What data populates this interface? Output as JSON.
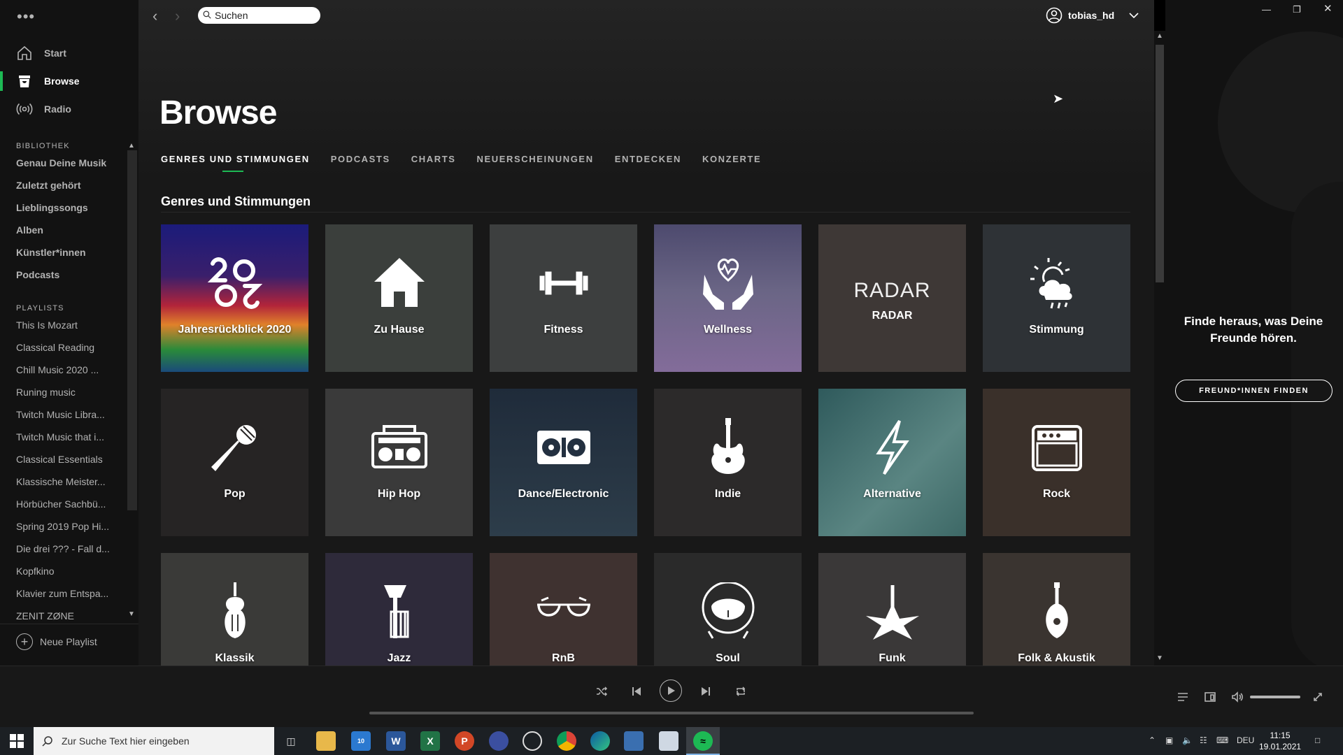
{
  "topbar": {
    "search_placeholder": "Suchen",
    "username": "tobias_hd"
  },
  "sidebar": {
    "nav": [
      {
        "label": "Start",
        "icon": "home-icon"
      },
      {
        "label": "Browse",
        "icon": "browse-icon",
        "active": true
      },
      {
        "label": "Radio",
        "icon": "radio-icon"
      }
    ],
    "library_heading": "BIBLIOTHEK",
    "library": [
      "Genau Deine Musik",
      "Zuletzt gehört",
      "Lieblingssongs",
      "Alben",
      "Künstler*innen",
      "Podcasts"
    ],
    "playlists_heading": "PLAYLISTS",
    "playlists": [
      "This Is Mozart",
      "Classical Reading",
      "Chill Music 2020 ...",
      "Runing music",
      "Twitch Music Libra...",
      "Twitch Music that i...",
      "Classical Essentials",
      "Klassische Meister...",
      "Hörbücher Sachbü...",
      "Spring 2019 Pop Hi...",
      "Die drei ??? - Fall d...",
      "Kopfkino",
      "Klavier zum Entspa...",
      "ZENIT ZØNE"
    ],
    "new_playlist": "Neue Playlist"
  },
  "main": {
    "title": "Browse",
    "tabs": [
      "GENRES UND STIMMUNGEN",
      "PODCASTS",
      "CHARTS",
      "NEUERSCHEINUNGEN",
      "ENTDECKEN",
      "KONZERTE"
    ],
    "section_title": "Genres und Stimmungen",
    "tiles": [
      {
        "label": "Jahresrückblick 2020",
        "icon": "year-2020-icon",
        "bg": "linear-gradient(180deg,#1b1b7a 0%,#3a1f6b 35%,#b2243a 55%,#e0812a 68%,#2a8a3a 85%,#1a4a7a 100%)"
      },
      {
        "label": "Zu Hause",
        "icon": "house-icon",
        "bg": "#3b3f3c"
      },
      {
        "label": "Fitness",
        "icon": "dumbbell-icon",
        "bg": "#3d3f3f"
      },
      {
        "label": "Wellness",
        "icon": "heart-hands-icon",
        "bg": "linear-gradient(180deg,#4d4a6e 0%,#6a6585 45%,#836c9a 100%)"
      },
      {
        "label": "RADAR",
        "icon": "radar-text",
        "bg": "#3e3836"
      },
      {
        "label": "Stimmung",
        "icon": "sun-cloud-icon",
        "bg": "#2e3236"
      },
      {
        "label": "Pop",
        "icon": "microphone-icon",
        "bg": "#262424"
      },
      {
        "label": "Hip Hop",
        "icon": "boombox-icon",
        "bg": "#3a3a3a"
      },
      {
        "label": "Dance/Electronic",
        "icon": "turntable-icon",
        "bg": "linear-gradient(180deg,#1f2b3a,#2d3d4a)"
      },
      {
        "label": "Indie",
        "icon": "guitar-icon",
        "bg": "#2c2a2a"
      },
      {
        "label": "Alternative",
        "icon": "lightning-icon",
        "bg": "linear-gradient(135deg,#2f5a5c 0%,#5a8582 60%,#3d6866 100%)"
      },
      {
        "label": "Rock",
        "icon": "amp-icon",
        "bg": "#3a302a"
      },
      {
        "label": "Klassik",
        "icon": "violin-icon",
        "bg": "#3a3a38"
      },
      {
        "label": "Jazz",
        "icon": "trumpet-icon",
        "bg": "#2e2a3a"
      },
      {
        "label": "RnB",
        "icon": "glasses-icon",
        "bg": "#3f3230"
      },
      {
        "label": "Soul",
        "icon": "afro-face-icon",
        "bg": "#2a2a2a"
      },
      {
        "label": "Funk",
        "icon": "star-guitar-icon",
        "bg": "#3a3838"
      },
      {
        "label": "Folk & Akustik",
        "icon": "mandolin-icon",
        "bg": "#3a3430"
      }
    ]
  },
  "friends": {
    "text": "Finde heraus, was Deine Freunde hören.",
    "button": "FREUND*INNEN FINDEN"
  },
  "taskbar": {
    "search_placeholder": "Zur Suche Text hier eingeben",
    "language": "DEU",
    "time": "11:15",
    "date": "19.01.2021",
    "mail_badge": "10"
  }
}
